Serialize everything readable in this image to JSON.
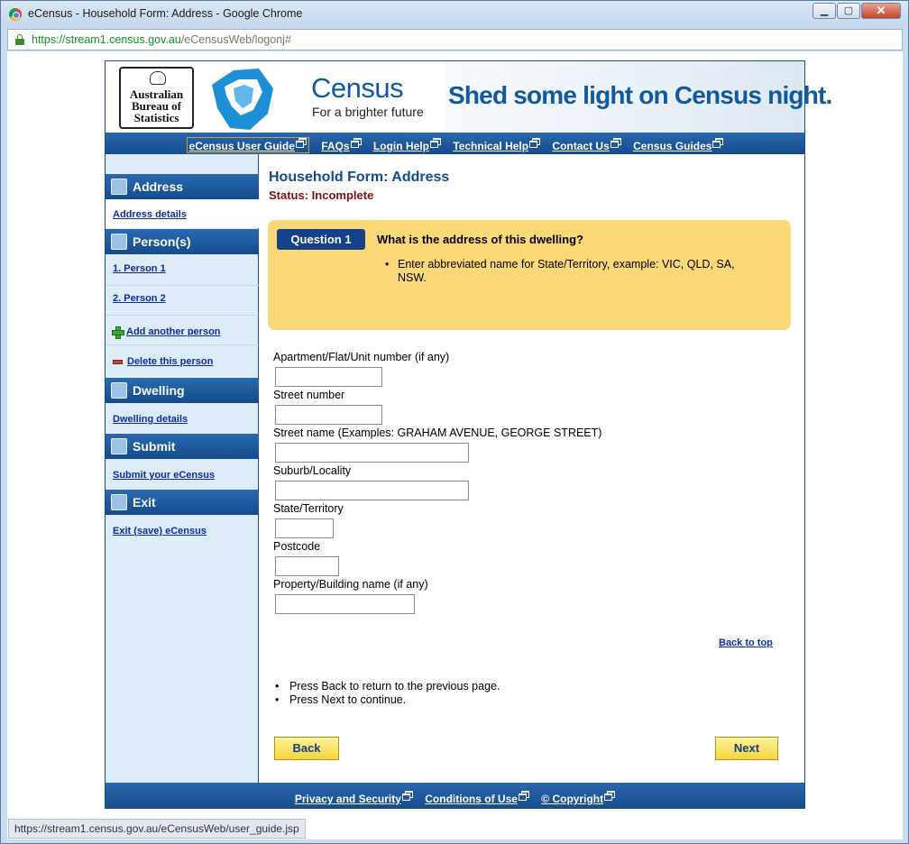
{
  "window": {
    "title": "eCensus - Household Form: Address - Google Chrome",
    "url_secure": "https://stream1.census.gov.au",
    "url_path": "/eCensusWeb/logonj#",
    "status_url": "https://stream1.census.gov.au/eCensusWeb/user_guide.jsp"
  },
  "banner": {
    "abs_logo_lines": [
      "Australian",
      "Bureau of",
      "Statistics"
    ],
    "census_word": "Census",
    "census_tagline": "For a brighter future",
    "slogan": "Shed some light on Census night.",
    "brand_color": "#0e5a9c"
  },
  "topnav": {
    "items": [
      "eCensus User Guide",
      "FAQs",
      "Login Help",
      "Technical Help",
      "Contact Us",
      "Census Guides"
    ]
  },
  "sidebar": {
    "address": {
      "heading": "Address",
      "link": "Address details"
    },
    "persons": {
      "heading": "Person(s)",
      "links": [
        "1. Person 1",
        "2. Person 2"
      ],
      "add": "Add another person",
      "delete": "Delete this person"
    },
    "dwelling": {
      "heading": "Dwelling",
      "link": "Dwelling details"
    },
    "submit": {
      "heading": "Submit",
      "link": "Submit your eCensus"
    },
    "exit": {
      "heading": "Exit",
      "link": "Exit (save) eCensus"
    }
  },
  "main": {
    "title": "Household Form: Address",
    "status": "Status: Incomplete",
    "question": {
      "badge": "Question 1",
      "text": "What is the address of this dwelling?",
      "hint": "Enter abbreviated name for State/Territory, example: VIC, QLD, SA, NSW."
    },
    "fields": {
      "apartment": "Apartment/Flat/Unit number (if any)",
      "street_number": "Street number",
      "street_name": "Street name (Examples: GRAHAM AVENUE, GEORGE STREET)",
      "suburb": "Suburb/Locality",
      "state": "State/Territory",
      "postcode": "Postcode",
      "property": "Property/Building name (if any)"
    },
    "back_to_top": "Back to top",
    "instructions": [
      "Press Back to return to the previous page.",
      "Press Next to continue."
    ],
    "back_button": "Back",
    "next_button": "Next"
  },
  "footer": {
    "items": [
      "Privacy and Security",
      "Conditions of Use",
      "© Copyright"
    ]
  }
}
